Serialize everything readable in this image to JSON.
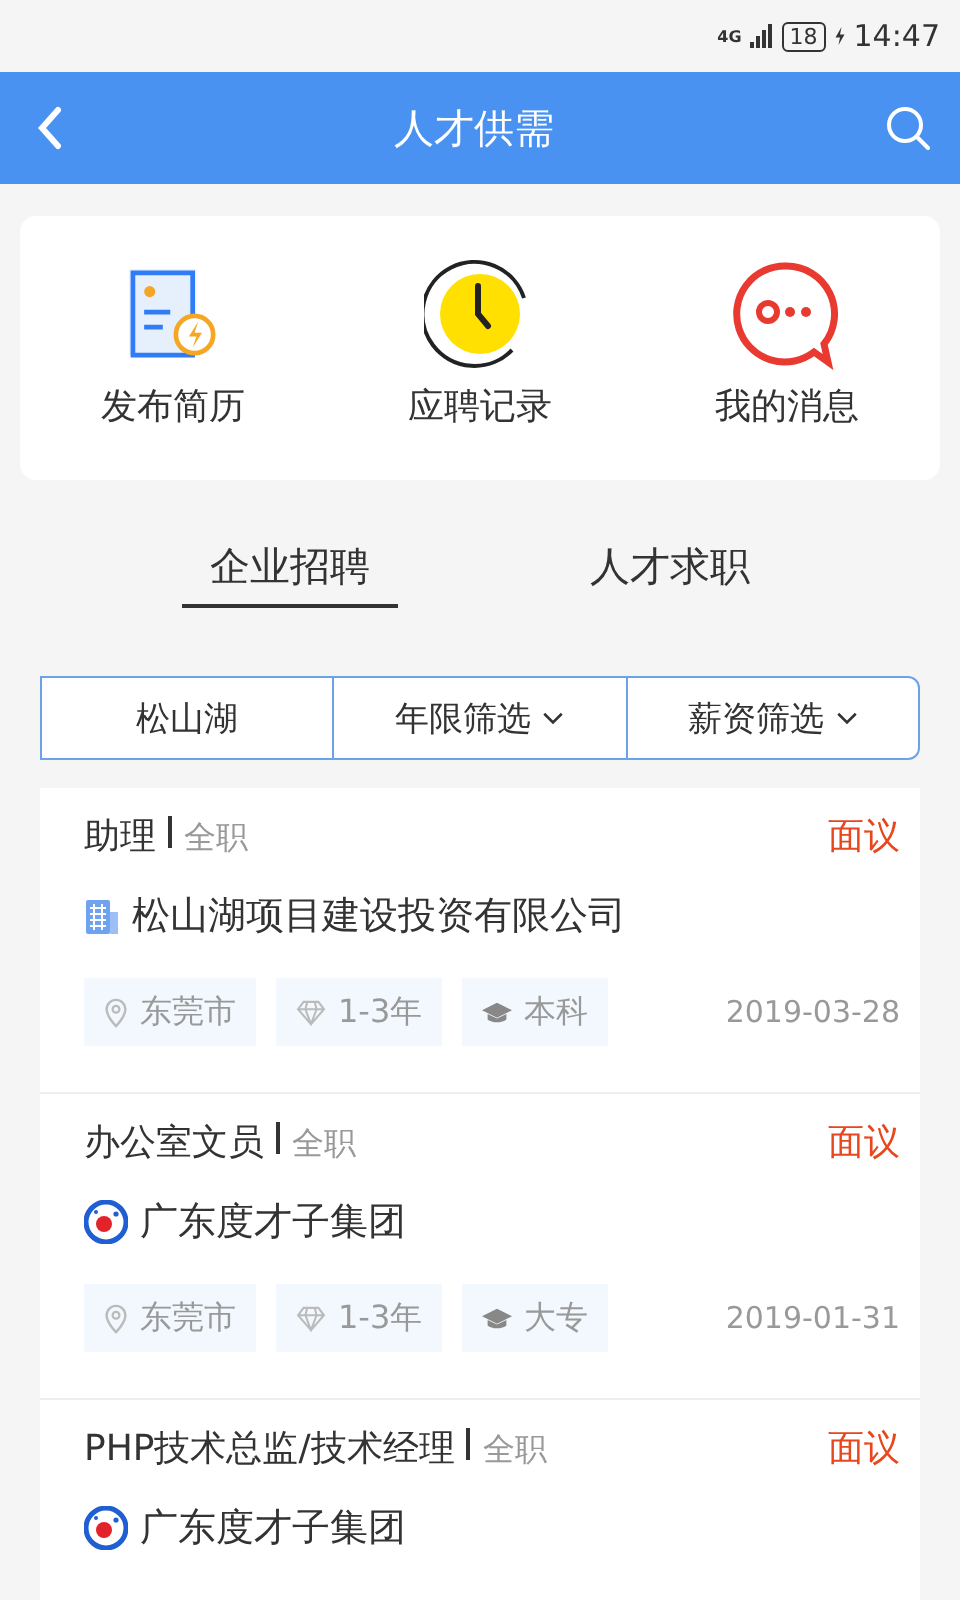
{
  "status_bar": {
    "network": "4G",
    "battery": "18",
    "time": "14:47"
  },
  "header": {
    "title": "人才供需"
  },
  "quick_actions": [
    {
      "kind": "resume",
      "label": "发布简历"
    },
    {
      "kind": "clock",
      "label": "应聘记录"
    },
    {
      "kind": "message",
      "label": "我的消息"
    }
  ],
  "tabs": [
    {
      "label": "企业招聘",
      "selected": true
    },
    {
      "label": "人才求职",
      "selected": false
    }
  ],
  "filters": [
    {
      "label": "松山湖",
      "dropdown": false
    },
    {
      "label": "年限筛选",
      "dropdown": true
    },
    {
      "label": "薪资筛选",
      "dropdown": true
    }
  ],
  "jobs": [
    {
      "title": "助理",
      "type": "全职",
      "salary": "面议",
      "company": {
        "kind": "building",
        "name": "松山湖项目建设投资有限公司"
      },
      "tags": [
        {
          "kind": "location",
          "text": "东莞市"
        },
        {
          "kind": "experience",
          "text": "1-3年"
        },
        {
          "kind": "education",
          "text": "本科"
        }
      ],
      "date": "2019-03-28"
    },
    {
      "title": "办公室文员",
      "type": "全职",
      "salary": "面议",
      "company": {
        "kind": "round",
        "name": "广东度才子集团"
      },
      "tags": [
        {
          "kind": "location",
          "text": "东莞市"
        },
        {
          "kind": "experience",
          "text": "1-3年"
        },
        {
          "kind": "education",
          "text": "大专"
        }
      ],
      "date": "2019-01-31"
    },
    {
      "title": "PHP技术总监/技术经理",
      "type": "全职",
      "salary": "面议",
      "company": {
        "kind": "round",
        "name": "广东度才子集团"
      }
    }
  ]
}
